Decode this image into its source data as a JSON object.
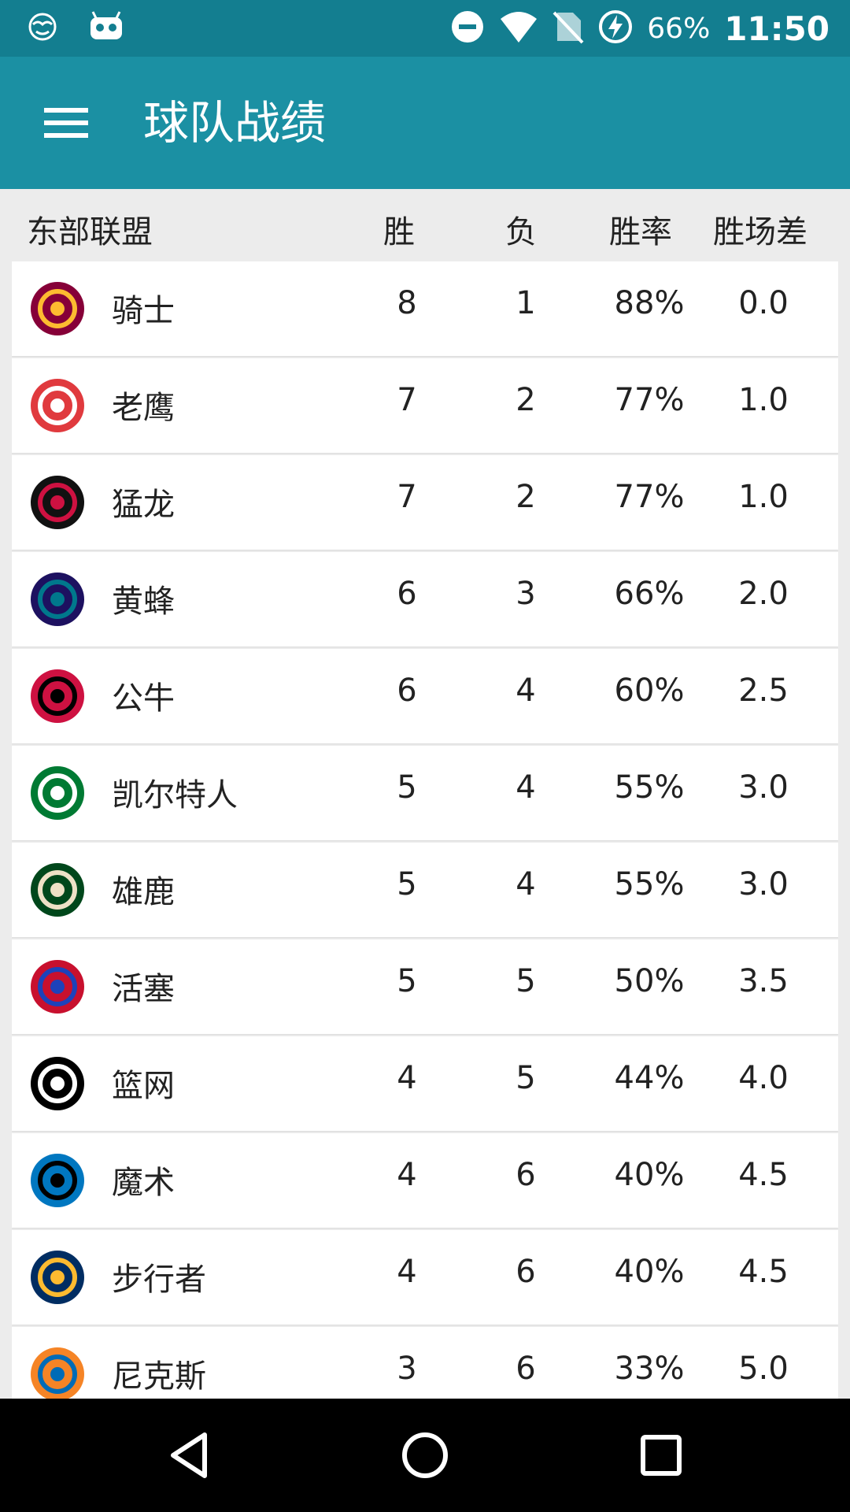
{
  "status_bar": {
    "battery": "66%",
    "time": "11:50",
    "icons": [
      "mask-icon",
      "android-icon",
      "do-not-disturb-icon",
      "wifi-icon",
      "no-sim-icon",
      "battery-charging-icon"
    ]
  },
  "app_bar": {
    "title": "球队战绩",
    "menu_icon": "hamburger-menu-icon"
  },
  "table": {
    "columns": {
      "conference": "东部联盟",
      "wins": "胜",
      "losses": "负",
      "pct": "胜率",
      "games_behind": "胜场差"
    },
    "rows": [
      {
        "team": "骑士",
        "w": "8",
        "l": "1",
        "pct": "88%",
        "gb": "0.0",
        "logo": "cavaliers-logo",
        "c1": "#860038",
        "c2": "#fdbb30"
      },
      {
        "team": "老鹰",
        "w": "7",
        "l": "2",
        "pct": "77%",
        "gb": "1.0",
        "logo": "hawks-logo",
        "c1": "#e03a3e",
        "c2": "#ffffff"
      },
      {
        "team": "猛龙",
        "w": "7",
        "l": "2",
        "pct": "77%",
        "gb": "1.0",
        "logo": "raptors-logo",
        "c1": "#111111",
        "c2": "#ce1141"
      },
      {
        "team": "黄蜂",
        "w": "6",
        "l": "3",
        "pct": "66%",
        "gb": "2.0",
        "logo": "hornets-logo",
        "c1": "#1d1160",
        "c2": "#00788c"
      },
      {
        "team": "公牛",
        "w": "6",
        "l": "4",
        "pct": "60%",
        "gb": "2.5",
        "logo": "bulls-logo",
        "c1": "#ce1141",
        "c2": "#000000"
      },
      {
        "team": "凯尔特人",
        "w": "5",
        "l": "4",
        "pct": "55%",
        "gb": "3.0",
        "logo": "celtics-logo",
        "c1": "#007a33",
        "c2": "#ffffff"
      },
      {
        "team": "雄鹿",
        "w": "5",
        "l": "4",
        "pct": "55%",
        "gb": "3.0",
        "logo": "bucks-logo",
        "c1": "#00471b",
        "c2": "#eee1c6"
      },
      {
        "team": "活塞",
        "w": "5",
        "l": "5",
        "pct": "50%",
        "gb": "3.5",
        "logo": "pistons-logo",
        "c1": "#c8102e",
        "c2": "#1d42ba"
      },
      {
        "team": "篮网",
        "w": "4",
        "l": "5",
        "pct": "44%",
        "gb": "4.0",
        "logo": "nets-logo",
        "c1": "#000000",
        "c2": "#ffffff"
      },
      {
        "team": "魔术",
        "w": "4",
        "l": "6",
        "pct": "40%",
        "gb": "4.5",
        "logo": "magic-logo",
        "c1": "#0077c0",
        "c2": "#000000"
      },
      {
        "team": "步行者",
        "w": "4",
        "l": "6",
        "pct": "40%",
        "gb": "4.5",
        "logo": "pacers-logo",
        "c1": "#002d62",
        "c2": "#fdbb30"
      },
      {
        "team": "尼克斯",
        "w": "3",
        "l": "6",
        "pct": "33%",
        "gb": "5.0",
        "logo": "knicks-logo",
        "c1": "#f58426",
        "c2": "#006bb6"
      }
    ]
  },
  "nav_bar": {
    "icons": [
      "back-icon",
      "home-icon",
      "recents-icon"
    ]
  },
  "colors": {
    "status_bar": "#137e90",
    "app_bar": "#1b90a3",
    "background": "#ececec",
    "nav_bar": "#000000"
  }
}
